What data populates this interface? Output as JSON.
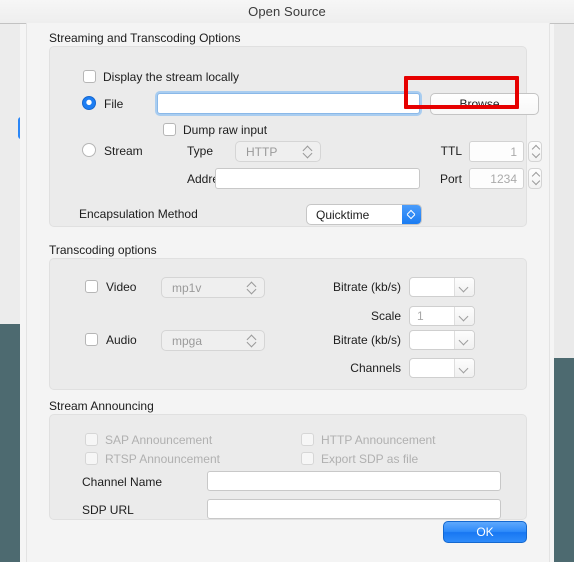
{
  "window": {
    "title": "Open Source"
  },
  "streaming_group": {
    "title": "Streaming and Transcoding Options",
    "display_locally": {
      "label": "Display the stream locally",
      "checked": false
    },
    "file_radio": {
      "label": "File",
      "selected": true
    },
    "file_path": {
      "value": "",
      "placeholder": ""
    },
    "browse_button": {
      "label": "Browse..."
    },
    "dump_raw_input": {
      "label": "Dump raw input",
      "checked": false
    },
    "stream_radio": {
      "label": "Stream",
      "selected": false
    },
    "type": {
      "label": "Type",
      "value": "HTTP",
      "enabled": false
    },
    "address": {
      "label": "Address",
      "value": ""
    },
    "ttl": {
      "label": "TTL",
      "value": "1"
    },
    "port": {
      "label": "Port",
      "value": "1234"
    },
    "encapsulation": {
      "label": "Encapsulation Method",
      "value": "Quicktime"
    }
  },
  "transcoding_group": {
    "title": "Transcoding options",
    "video": {
      "label": "Video",
      "checked": false,
      "codec": "mp1v",
      "bitrate_label": "Bitrate (kb/s)",
      "bitrate_value": "",
      "scale_label": "Scale",
      "scale_value": "1"
    },
    "audio": {
      "label": "Audio",
      "checked": false,
      "codec": "mpga",
      "bitrate_label": "Bitrate (kb/s)",
      "bitrate_value": "",
      "channels_label": "Channels",
      "channels_value": ""
    }
  },
  "announcing_group": {
    "title": "Stream Announcing",
    "sap": {
      "label": "SAP Announcement",
      "checked": false
    },
    "http": {
      "label": "HTTP Announcement",
      "checked": false
    },
    "rtsp": {
      "label": "RTSP Announcement",
      "checked": false
    },
    "export_sdp": {
      "label": "Export SDP as file",
      "checked": false
    },
    "channel_name": {
      "label": "Channel Name",
      "value": ""
    },
    "sdp_url": {
      "label": "SDP URL",
      "value": ""
    }
  },
  "footer": {
    "ok_label": "OK"
  },
  "colors": {
    "accent_blue": "#1877f2",
    "annotation_red": "#e60000",
    "desktop": "#4d6a70",
    "group_bg": "#ebebeb",
    "sheet_bg": "#f4f4f4"
  }
}
